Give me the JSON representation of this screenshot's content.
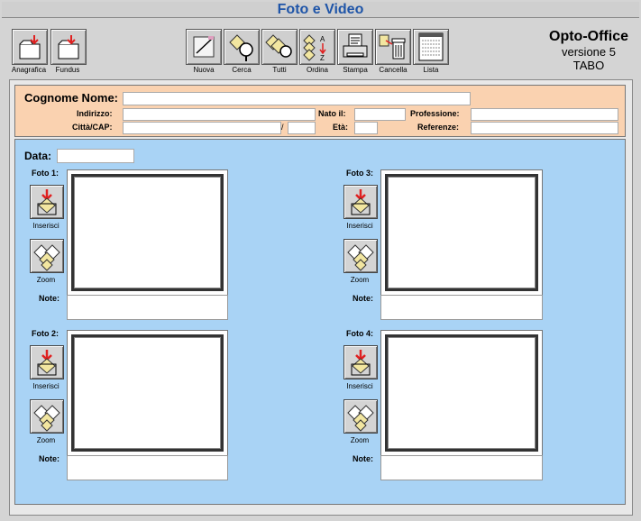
{
  "window": {
    "title": "Foto e Video"
  },
  "toolbar_left": [
    {
      "label": "Anagrafica"
    },
    {
      "label": "Fundus"
    }
  ],
  "toolbar_right": [
    {
      "label": "Nuova"
    },
    {
      "label": "Cerca"
    },
    {
      "label": "Tutti"
    },
    {
      "label": "Ordina"
    },
    {
      "label": "Stampa"
    },
    {
      "label": "Cancella"
    },
    {
      "label": "Lista"
    }
  ],
  "brand": {
    "name": "Opto-Office",
    "version": "versione 5",
    "user": "TABO"
  },
  "patient": {
    "cognome_nome_label": "Cognome Nome:",
    "indirizzo_label": "Indirizzo:",
    "citta_cap_label": "Città/CAP:",
    "cap_separator": "/",
    "nato_il_label": "Nato il:",
    "eta_label": "Età:",
    "professione_label": "Professione:",
    "referenze_label": "Referenze:"
  },
  "photos": {
    "data_label": "Data:",
    "items": [
      {
        "label": "Foto 1:"
      },
      {
        "label": "Foto 2:"
      },
      {
        "label": "Foto 3:"
      },
      {
        "label": "Foto 4:"
      }
    ],
    "insert_label": "Inserisci",
    "zoom_label": "Zoom",
    "note_label": "Note:"
  }
}
